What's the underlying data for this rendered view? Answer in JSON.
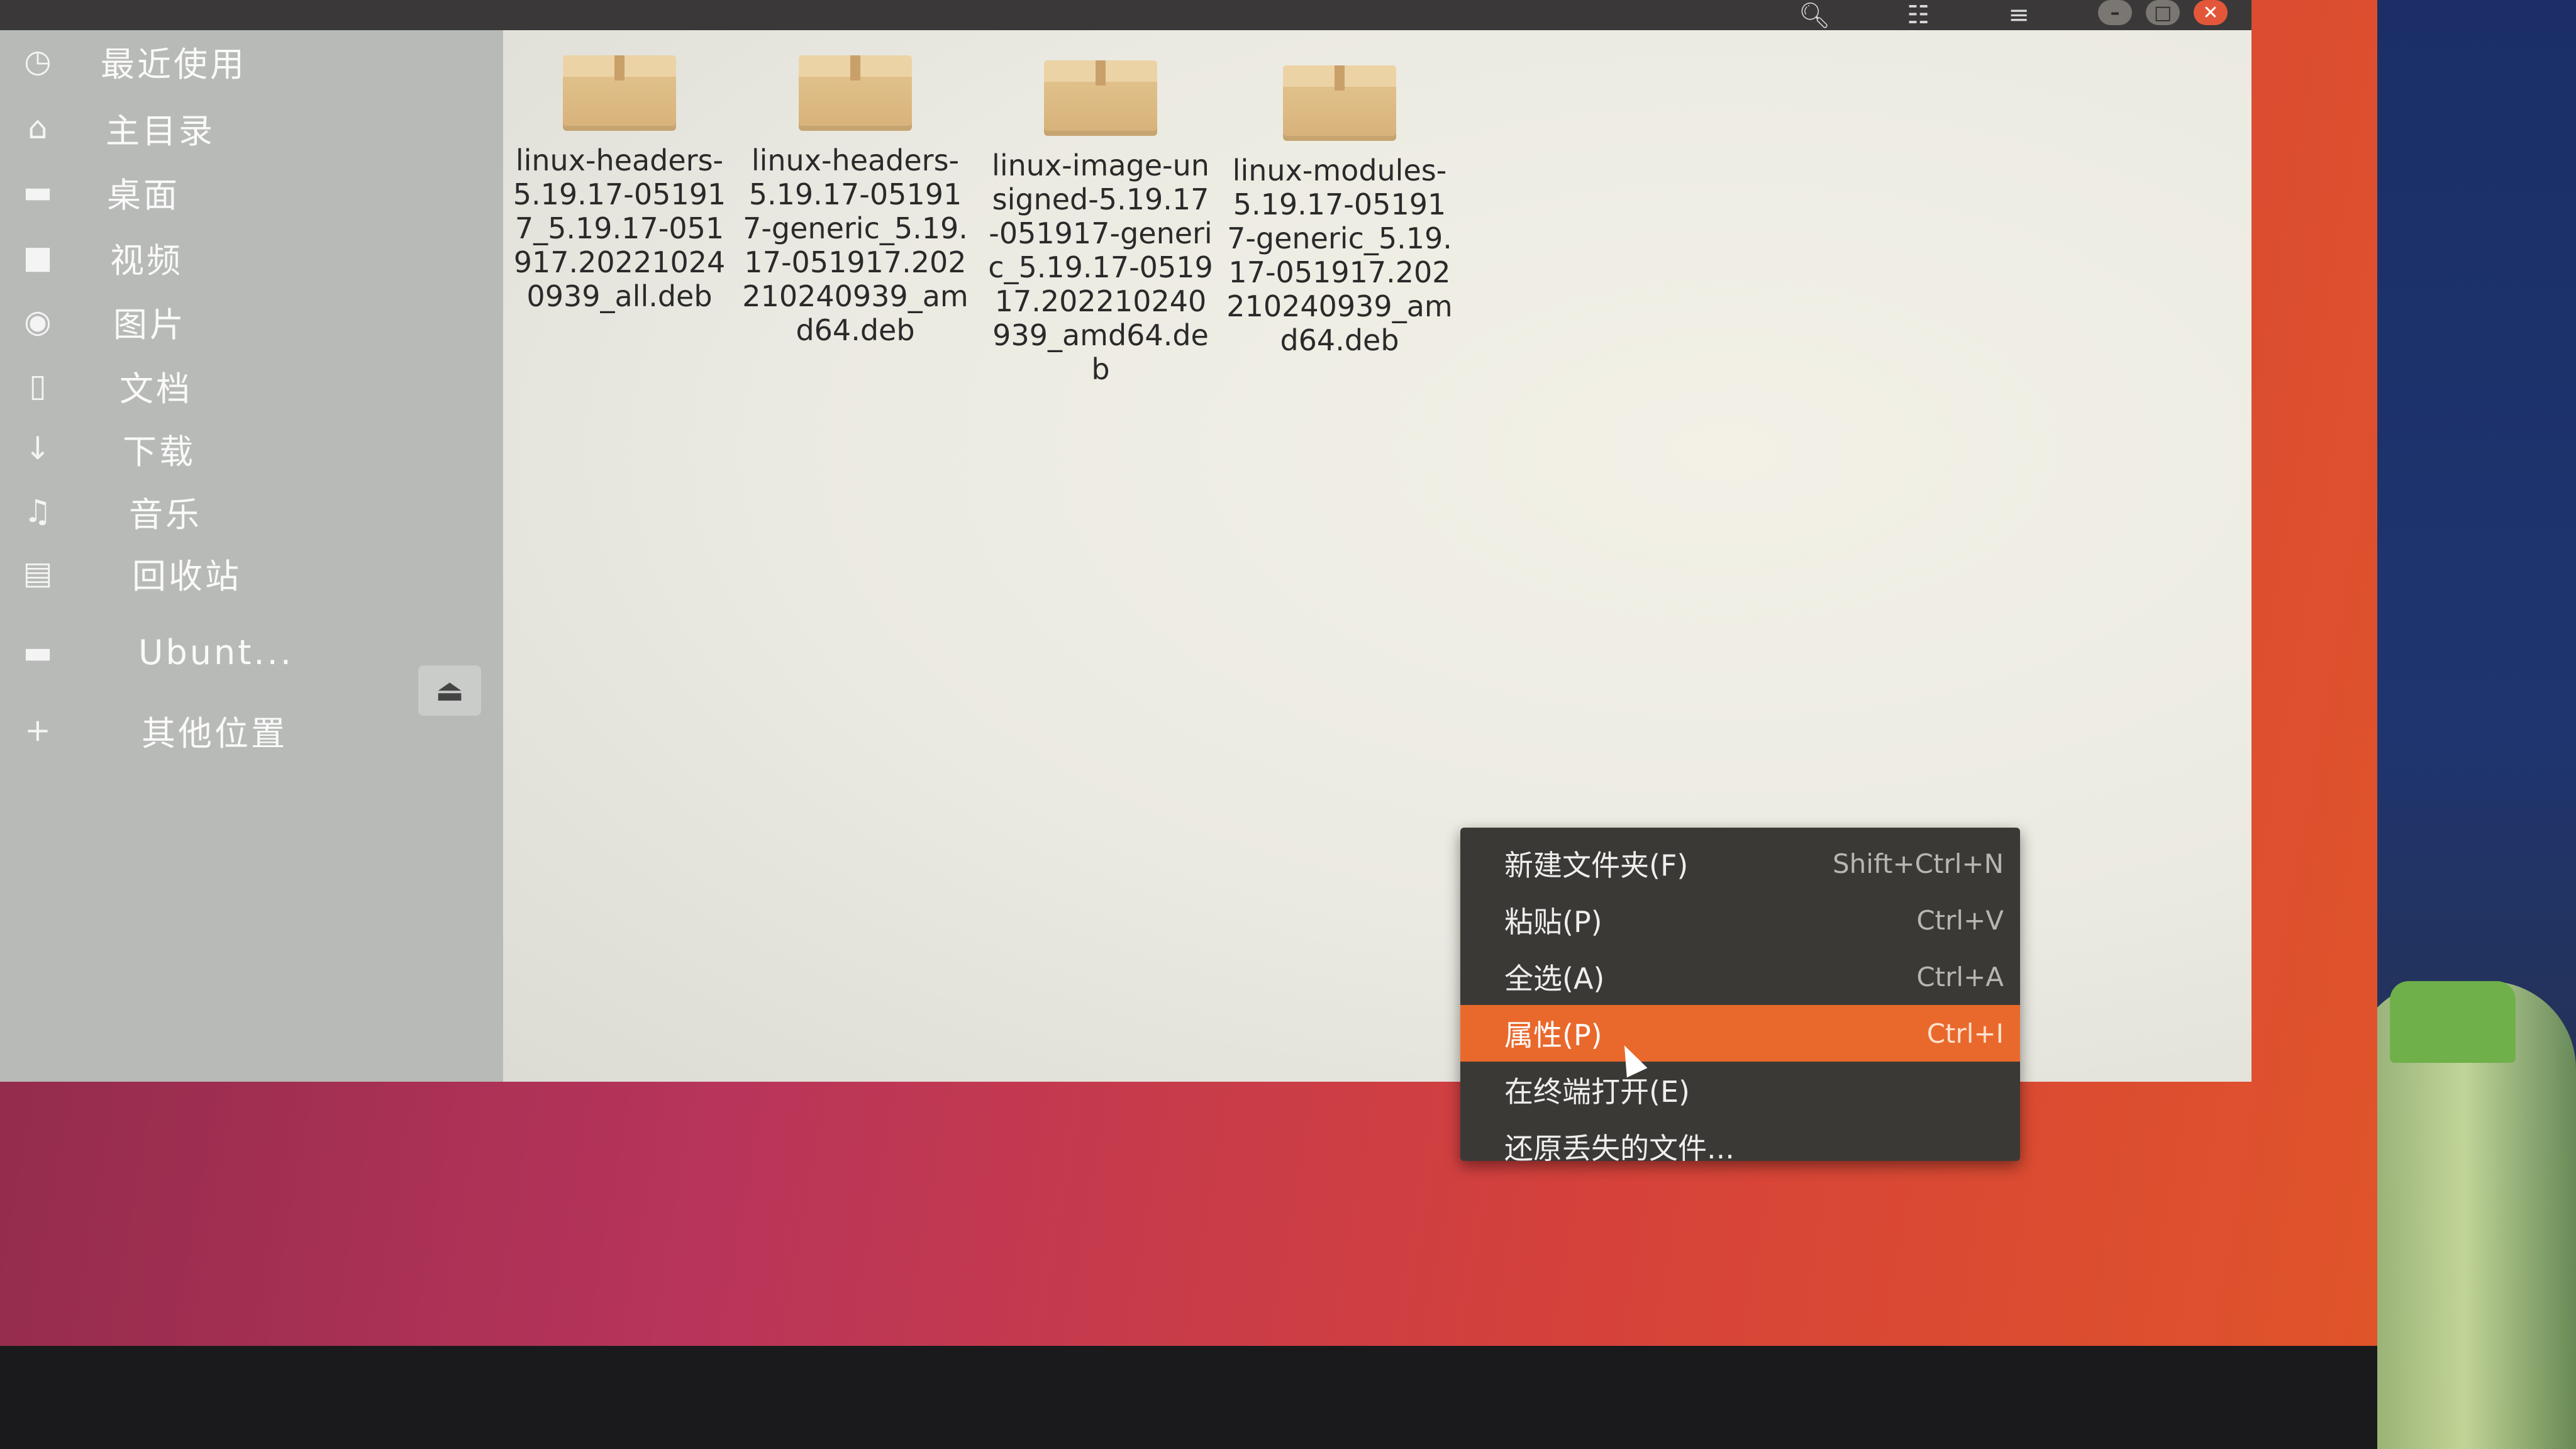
{
  "titlebar": {
    "search_icon": "search-icon",
    "view_icon": "grid-view-icon",
    "menu_icon": "hamburger-menu-icon"
  },
  "sidebar": {
    "items": [
      {
        "label": "最近使用",
        "icon": "clock-icon"
      },
      {
        "label": "主目录",
        "icon": "home-icon"
      },
      {
        "label": "桌面",
        "icon": "folder-icon"
      },
      {
        "label": "视频",
        "icon": "video-icon"
      },
      {
        "label": "图片",
        "icon": "camera-icon"
      },
      {
        "label": "文档",
        "icon": "document-icon"
      },
      {
        "label": "下载",
        "icon": "download-icon"
      },
      {
        "label": "音乐",
        "icon": "music-icon"
      },
      {
        "label": "回收站",
        "icon": "trash-icon"
      },
      {
        "label": "Ubunt...",
        "icon": "drive-icon"
      },
      {
        "label": "其他位置",
        "icon": "plus-icon"
      }
    ]
  },
  "files": [
    {
      "name": "linux-headers-5.19.17-051917_5.19.17-051917.202210240939_all.deb"
    },
    {
      "name": "linux-headers-5.19.17-051917-generic_5.19.17-051917.202210240939_amd64.deb"
    },
    {
      "name": "linux-image-unsigned-5.19.17-051917-generic_5.19.17-051917.202210240939_amd64.deb"
    },
    {
      "name": "linux-modules-5.19.17-051917-generic_5.19.17-051917.202210240939_amd64.deb"
    }
  ],
  "context_menu": {
    "items": [
      {
        "label": "新建文件夹(F)",
        "accel": "Shift+Ctrl+N"
      },
      {
        "label": "粘贴(P)",
        "accel": "Ctrl+V"
      },
      {
        "label": "全选(A)",
        "accel": "Ctrl+A"
      },
      {
        "label": "属性(P)",
        "accel": "Ctrl+I"
      },
      {
        "label": "在终端打开(E)",
        "accel": ""
      },
      {
        "label": "还原丢失的文件...",
        "accel": ""
      }
    ],
    "highlighted_index": 3
  },
  "colors": {
    "accent": "#e9692c",
    "sidebar_bg": "#b7bab6",
    "menu_bg": "#3b3936"
  }
}
